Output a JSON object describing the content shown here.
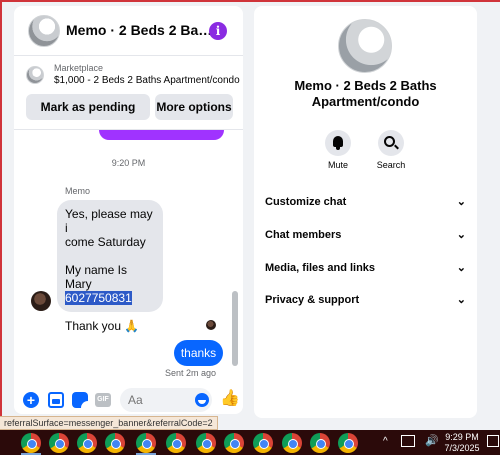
{
  "chat": {
    "title": "Memo · 2 Beds 2 Bath...",
    "info_glyph": "i",
    "marketplace_label": "Marketplace",
    "listing": "$1,000 - 2 Beds 2 Baths Apartment/condo",
    "mark_pending_label": "Mark as pending",
    "more_options_label": "More options",
    "time_separator": "9:20 PM",
    "sender_name": "Memo",
    "incoming_message": {
      "line1": "Yes, please may i",
      "line2": "come Saturday",
      "line3": "My name Is Mary",
      "phone": "6027750831",
      "line4": "Thank you 🙏"
    },
    "outgoing_message": "thanks",
    "sent_status": "Sent 2m ago",
    "composer_placeholder": "Aa",
    "gif_label": "GIF",
    "plus_glyph": "+",
    "like_glyph": "👍"
  },
  "info_panel": {
    "name": "Memo · 2 Beds 2 Baths Apartment/condo",
    "actions": [
      {
        "label": "Mute",
        "icon": "bell-icon"
      },
      {
        "label": "Search",
        "icon": "search-icon"
      }
    ],
    "sections": [
      {
        "label": "Customize chat"
      },
      {
        "label": "Chat members"
      },
      {
        "label": "Media, files and links"
      },
      {
        "label": "Privacy & support"
      }
    ],
    "chevron": "⌄"
  },
  "status_bar": {
    "url_fragment": "referralSurface=messenger_banner&referralCode=2"
  },
  "taskbar": {
    "time": "9:29 PM",
    "date": "7/3/2025",
    "tray_arrow": "^",
    "volume_glyph": "🔊"
  },
  "colors": {
    "messenger_blue": "#0866ff",
    "purple": "#a033ff",
    "taskbar": "#2b0a0a"
  }
}
